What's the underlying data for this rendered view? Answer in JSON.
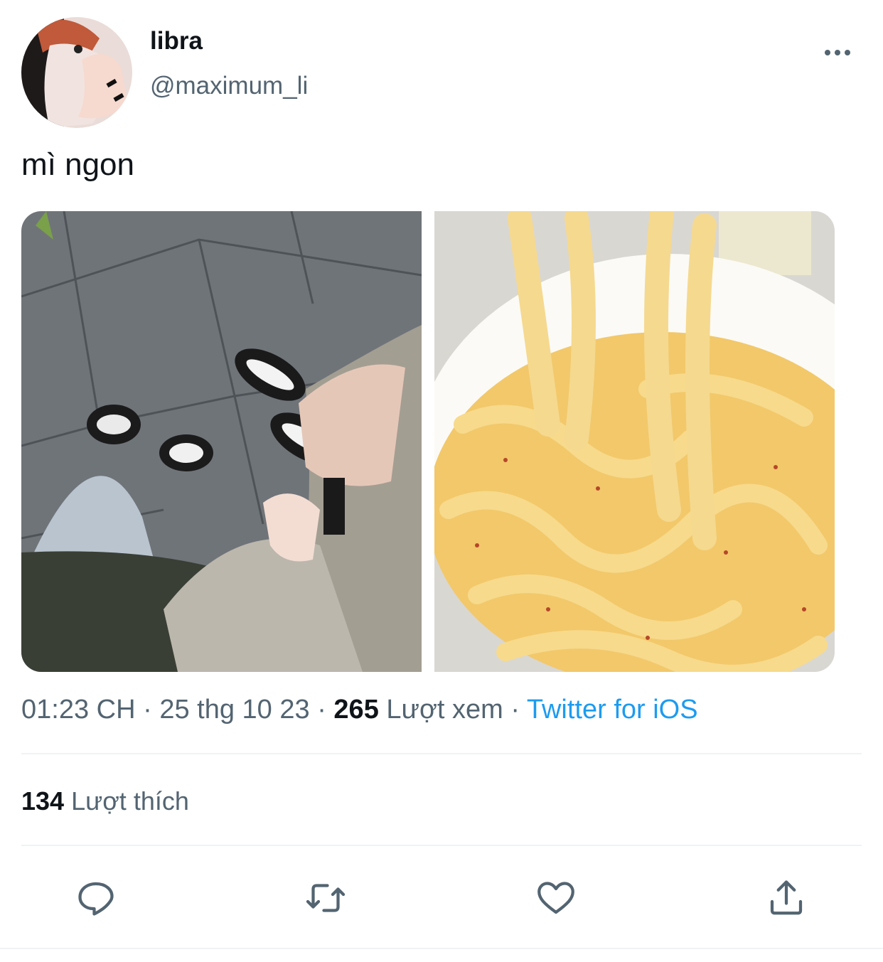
{
  "author": {
    "display_name": "libra",
    "handle": "@maximum_li",
    "avatar_icon": "avatar-photo"
  },
  "tweet": {
    "text": "mì ngon"
  },
  "media": [
    {
      "description_icon": "photo-sneakers"
    },
    {
      "description_icon": "photo-noodles"
    }
  ],
  "meta": {
    "time": "01:23 CH",
    "separator1": " · ",
    "date": "25 thg 10 23",
    "separator2": " · ",
    "views_count": "265",
    "views_label": " Lượt xem",
    "separator3": " · ",
    "source": "Twitter for iOS"
  },
  "likes": {
    "count": "134",
    "label": " Lượt thích"
  },
  "icons": {
    "more": "more-horizontal-icon",
    "reply": "reply-icon",
    "retweet": "retweet-icon",
    "like": "heart-icon",
    "share": "share-icon"
  },
  "colors": {
    "text_primary": "#0f1419",
    "text_secondary": "#536471",
    "link": "#1d9bf0",
    "divider": "#eff3f4"
  }
}
